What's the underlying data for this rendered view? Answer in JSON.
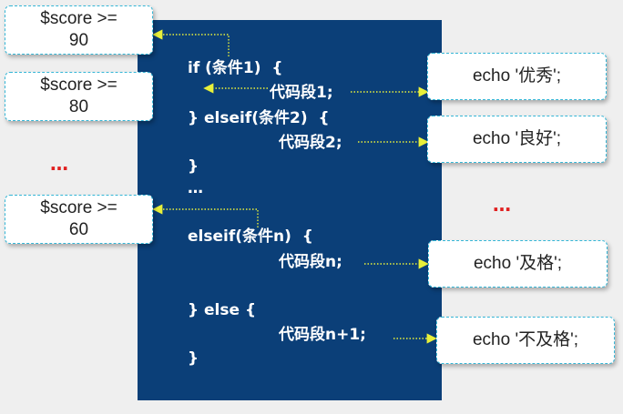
{
  "code": {
    "if_line": "if (条件1)  {",
    "seg1": "代码段1;",
    "elseif_line": "} elseif(条件2)  {",
    "seg2": "代码段2;",
    "close1": "}",
    "ellipsis": "…",
    "elseif_n_line": "elseif(条件n)  {",
    "seg_n": "代码段n;",
    "else_line": "} else {",
    "seg_n1": "代码段n+1;",
    "close2": "}"
  },
  "conditions": [
    {
      "line1": "$score >=",
      "line2": "90"
    },
    {
      "line1": "$score >=",
      "line2": "80"
    },
    {
      "line1": "$score >=",
      "line2": "60"
    }
  ],
  "left_ellipsis": "…",
  "right_ellipsis": "…",
  "outputs": [
    "echo '优秀';",
    "echo '良好';",
    "echo '及格';",
    "echo '不及格';"
  ]
}
